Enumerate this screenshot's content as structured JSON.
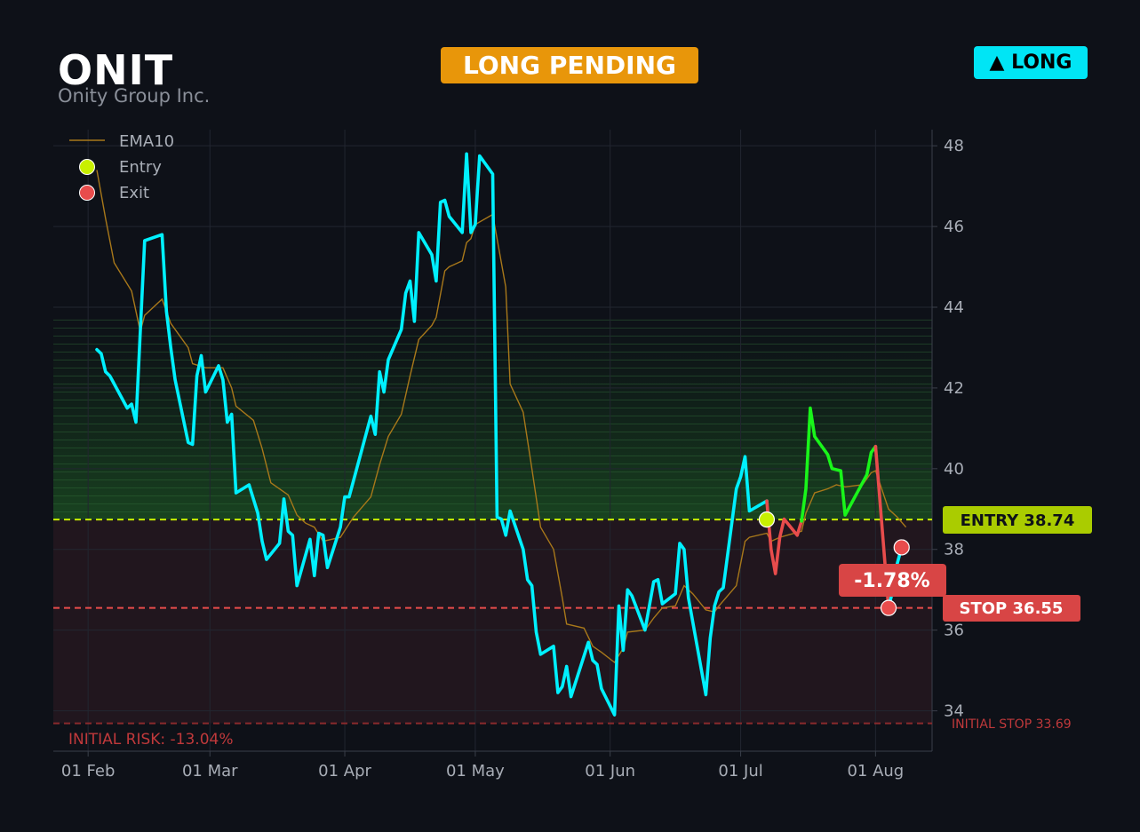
{
  "header": {
    "ticker": "ONIT",
    "company": "Onity Group Inc.",
    "status": "LONG PENDING",
    "direction": "▲ LONG"
  },
  "colors": {
    "background": "#0e1118",
    "price": "#00f0ff",
    "price_profit": "#19f51a",
    "price_loss": "#e84c4c",
    "ema": "#a8781a",
    "entry": "#c8f000",
    "stop": "#e84c4c",
    "status_badge": "#e8960a",
    "direction_badge": "#00e5f5"
  },
  "chart_data": {
    "type": "line",
    "x_ticks": [
      "01 Feb",
      "01 Mar",
      "01 Apr",
      "01 May",
      "01 Jun",
      "01 Jul",
      "01 Aug"
    ],
    "y_ticks": [
      34,
      36,
      38,
      40,
      42,
      44,
      46,
      48
    ],
    "ylim": [
      33.0,
      48.4
    ],
    "xlim": [
      "2025-01-24",
      "2025-08-14"
    ],
    "grid": true,
    "legend": {
      "position": "top-left",
      "entries": [
        {
          "label": "EMA10",
          "marker": "line"
        },
        {
          "label": "Entry",
          "marker": "dot"
        },
        {
          "label": "Exit",
          "marker": "dot"
        }
      ]
    },
    "series": [
      {
        "name": "Close",
        "points": [
          [
            "2025-02-03",
            42.95
          ],
          [
            "2025-02-04",
            42.85
          ],
          [
            "2025-02-05",
            42.4
          ],
          [
            "2025-02-06",
            42.3
          ],
          [
            "2025-02-10",
            41.5
          ],
          [
            "2025-02-11",
            41.6
          ],
          [
            "2025-02-12",
            41.15
          ],
          [
            "2025-02-14",
            45.65
          ],
          [
            "2025-02-18",
            45.8
          ],
          [
            "2025-02-19",
            43.9
          ],
          [
            "2025-02-20",
            43.0
          ],
          [
            "2025-02-21",
            42.2
          ],
          [
            "2025-02-24",
            40.65
          ],
          [
            "2025-02-25",
            40.6
          ],
          [
            "2025-02-26",
            42.3
          ],
          [
            "2025-02-27",
            42.8
          ],
          [
            "2025-02-28",
            41.9
          ],
          [
            "2025-03-03",
            42.55
          ],
          [
            "2025-03-04",
            42.2
          ],
          [
            "2025-03-05",
            41.15
          ],
          [
            "2025-03-06",
            41.35
          ],
          [
            "2025-03-07",
            39.4
          ],
          [
            "2025-03-10",
            39.6
          ],
          [
            "2025-03-12",
            38.9
          ],
          [
            "2025-03-13",
            38.2
          ],
          [
            "2025-03-14",
            37.75
          ],
          [
            "2025-03-17",
            38.15
          ],
          [
            "2025-03-18",
            39.25
          ],
          [
            "2025-03-19",
            38.45
          ],
          [
            "2025-03-20",
            38.35
          ],
          [
            "2025-03-21",
            37.1
          ],
          [
            "2025-03-24",
            38.25
          ],
          [
            "2025-03-25",
            37.35
          ],
          [
            "2025-03-26",
            38.4
          ],
          [
            "2025-03-27",
            38.35
          ],
          [
            "2025-03-28",
            37.55
          ],
          [
            "2025-03-31",
            38.55
          ],
          [
            "2025-04-01",
            39.3
          ],
          [
            "2025-04-02",
            39.3
          ],
          [
            "2025-04-03",
            39.7
          ],
          [
            "2025-04-07",
            41.3
          ],
          [
            "2025-04-08",
            40.85
          ],
          [
            "2025-04-09",
            42.4
          ],
          [
            "2025-04-10",
            41.9
          ],
          [
            "2025-04-11",
            42.7
          ],
          [
            "2025-04-14",
            43.45
          ],
          [
            "2025-04-15",
            44.35
          ],
          [
            "2025-04-16",
            44.65
          ],
          [
            "2025-04-17",
            43.65
          ],
          [
            "2025-04-18",
            45.85
          ],
          [
            "2025-04-21",
            45.3
          ],
          [
            "2025-04-22",
            44.65
          ],
          [
            "2025-04-23",
            46.6
          ],
          [
            "2025-04-24",
            46.65
          ],
          [
            "2025-04-25",
            46.25
          ],
          [
            "2025-04-28",
            45.85
          ],
          [
            "2025-04-29",
            47.8
          ],
          [
            "2025-04-30",
            45.85
          ],
          [
            "2025-05-01",
            46.05
          ],
          [
            "2025-05-02",
            47.75
          ],
          [
            "2025-05-05",
            47.3
          ],
          [
            "2025-05-06",
            38.8
          ],
          [
            "2025-05-07",
            38.75
          ],
          [
            "2025-05-08",
            38.35
          ],
          [
            "2025-05-09",
            38.95
          ],
          [
            "2025-05-12",
            38.0
          ],
          [
            "2025-05-13",
            37.25
          ],
          [
            "2025-05-14",
            37.1
          ],
          [
            "2025-05-15",
            35.95
          ],
          [
            "2025-05-16",
            35.4
          ],
          [
            "2025-05-19",
            35.6
          ],
          [
            "2025-05-20",
            34.45
          ],
          [
            "2025-05-21",
            34.6
          ],
          [
            "2025-05-22",
            35.1
          ],
          [
            "2025-05-23",
            34.35
          ],
          [
            "2025-05-27",
            35.7
          ],
          [
            "2025-05-28",
            35.25
          ],
          [
            "2025-05-29",
            35.15
          ],
          [
            "2025-05-30",
            34.55
          ],
          [
            "2025-06-02",
            33.9
          ],
          [
            "2025-06-03",
            36.6
          ],
          [
            "2025-06-04",
            35.5
          ],
          [
            "2025-06-05",
            37.0
          ],
          [
            "2025-06-06",
            36.85
          ],
          [
            "2025-06-09",
            36.0
          ],
          [
            "2025-06-10",
            36.6
          ],
          [
            "2025-06-11",
            37.2
          ],
          [
            "2025-06-12",
            37.25
          ],
          [
            "2025-06-13",
            36.65
          ],
          [
            "2025-06-16",
            36.9
          ],
          [
            "2025-06-17",
            38.15
          ],
          [
            "2025-06-18",
            38.0
          ],
          [
            "2025-06-19",
            36.8
          ],
          [
            "2025-06-23",
            34.4
          ],
          [
            "2025-06-24",
            35.8
          ],
          [
            "2025-06-25",
            36.6
          ],
          [
            "2025-06-26",
            36.95
          ],
          [
            "2025-06-27",
            37.05
          ],
          [
            "2025-06-30",
            39.5
          ],
          [
            "2025-07-01",
            39.8
          ],
          [
            "2025-07-02",
            40.3
          ],
          [
            "2025-07-03",
            38.95
          ],
          [
            "2025-07-07",
            39.2
          ],
          [
            "2025-07-08",
            38.0
          ],
          [
            "2025-07-09",
            37.4
          ],
          [
            "2025-07-10",
            38.3
          ],
          [
            "2025-07-11",
            38.75
          ],
          [
            "2025-07-14",
            38.35
          ],
          [
            "2025-07-15",
            38.7
          ],
          [
            "2025-07-16",
            39.5
          ],
          [
            "2025-07-17",
            41.5
          ],
          [
            "2025-07-18",
            40.8
          ],
          [
            "2025-07-21",
            40.35
          ],
          [
            "2025-07-22",
            40.0
          ],
          [
            "2025-07-24",
            39.95
          ],
          [
            "2025-07-25",
            38.85
          ],
          [
            "2025-07-28",
            39.45
          ],
          [
            "2025-07-29",
            39.65
          ],
          [
            "2025-07-30",
            39.85
          ],
          [
            "2025-07-31",
            40.4
          ],
          [
            "2025-08-01",
            40.55
          ],
          [
            "2025-08-04",
            36.55
          ],
          [
            "2025-08-05",
            37.0
          ],
          [
            "2025-08-06",
            37.65
          ],
          [
            "2025-08-07",
            38.05
          ]
        ]
      },
      {
        "name": "EMA10",
        "points": [
          [
            "2025-02-03",
            47.4
          ],
          [
            "2025-02-05",
            46.2
          ],
          [
            "2025-02-07",
            45.1
          ],
          [
            "2025-02-11",
            44.4
          ],
          [
            "2025-02-13",
            43.4
          ],
          [
            "2025-02-14",
            43.8
          ],
          [
            "2025-02-18",
            44.2
          ],
          [
            "2025-02-20",
            43.6
          ],
          [
            "2025-02-24",
            43.0
          ],
          [
            "2025-02-25",
            42.6
          ],
          [
            "2025-02-28",
            42.5
          ],
          [
            "2025-03-04",
            42.5
          ],
          [
            "2025-03-06",
            42.0
          ],
          [
            "2025-03-07",
            41.55
          ],
          [
            "2025-03-11",
            41.2
          ],
          [
            "2025-03-13",
            40.5
          ],
          [
            "2025-03-15",
            39.65
          ],
          [
            "2025-03-19",
            39.35
          ],
          [
            "2025-03-21",
            38.85
          ],
          [
            "2025-03-23",
            38.65
          ],
          [
            "2025-03-25",
            38.55
          ],
          [
            "2025-03-27",
            38.2
          ],
          [
            "2025-03-31",
            38.3
          ],
          [
            "2025-04-03",
            38.8
          ],
          [
            "2025-04-07",
            39.3
          ],
          [
            "2025-04-09",
            40.1
          ],
          [
            "2025-04-11",
            40.8
          ],
          [
            "2025-04-14",
            41.35
          ],
          [
            "2025-04-16",
            42.3
          ],
          [
            "2025-04-18",
            43.2
          ],
          [
            "2025-04-21",
            43.55
          ],
          [
            "2025-04-22",
            43.75
          ],
          [
            "2025-04-24",
            44.9
          ],
          [
            "2025-04-25",
            45.0
          ],
          [
            "2025-04-28",
            45.15
          ],
          [
            "2025-04-29",
            45.6
          ],
          [
            "2025-04-30",
            45.7
          ],
          [
            "2025-05-01",
            46.05
          ],
          [
            "2025-05-05",
            46.3
          ],
          [
            "2025-05-08",
            44.5
          ],
          [
            "2025-05-09",
            42.1
          ],
          [
            "2025-05-12",
            41.4
          ],
          [
            "2025-05-14",
            40.0
          ],
          [
            "2025-05-16",
            38.55
          ],
          [
            "2025-05-19",
            38.0
          ],
          [
            "2025-05-21",
            36.8
          ],
          [
            "2025-05-22",
            36.15
          ],
          [
            "2025-05-26",
            36.05
          ],
          [
            "2025-05-28",
            35.6
          ],
          [
            "2025-05-30",
            35.45
          ],
          [
            "2025-06-02",
            35.2
          ],
          [
            "2025-06-04",
            35.55
          ],
          [
            "2025-06-05",
            35.95
          ],
          [
            "2025-06-09",
            36.0
          ],
          [
            "2025-06-11",
            36.3
          ],
          [
            "2025-06-13",
            36.55
          ],
          [
            "2025-06-16",
            36.6
          ],
          [
            "2025-06-18",
            37.1
          ],
          [
            "2025-06-20",
            36.9
          ],
          [
            "2025-06-23",
            36.5
          ],
          [
            "2025-06-25",
            36.45
          ],
          [
            "2025-06-26",
            36.6
          ],
          [
            "2025-06-30",
            37.1
          ],
          [
            "2025-07-02",
            38.2
          ],
          [
            "2025-07-03",
            38.3
          ],
          [
            "2025-07-07",
            38.4
          ],
          [
            "2025-07-08",
            38.2
          ],
          [
            "2025-07-09",
            38.25
          ],
          [
            "2025-07-10",
            38.3
          ],
          [
            "2025-07-15",
            38.45
          ],
          [
            "2025-07-16",
            38.9
          ],
          [
            "2025-07-18",
            39.4
          ],
          [
            "2025-07-21",
            39.5
          ],
          [
            "2025-07-23",
            39.6
          ],
          [
            "2025-07-25",
            39.55
          ],
          [
            "2025-07-29",
            39.6
          ],
          [
            "2025-07-31",
            39.9
          ],
          [
            "2025-08-01",
            39.95
          ],
          [
            "2025-08-04",
            39.0
          ],
          [
            "2025-08-06",
            38.8
          ],
          [
            "2025-08-08",
            38.55
          ]
        ]
      }
    ],
    "trade_segments": [
      {
        "from": "2025-07-07",
        "to": "2025-07-15",
        "result": "loss"
      },
      {
        "from": "2025-07-15",
        "to": "2025-08-01",
        "result": "profit"
      },
      {
        "from": "2025-08-01",
        "to": "2025-08-04",
        "result": "loss"
      }
    ],
    "markers": [
      {
        "type": "entry",
        "date": "2025-07-07",
        "value": 38.74
      },
      {
        "type": "exit",
        "date": "2025-08-04",
        "value": 36.55
      },
      {
        "type": "exit",
        "date": "2025-08-07",
        "value": 38.05
      }
    ],
    "levels": {
      "entry": 38.74,
      "stop": 36.55,
      "initial_stop": 33.69
    },
    "labels": {
      "entry": "ENTRY 38.74",
      "stop": "STOP 36.55",
      "pnl": "-1.78%",
      "initial_stop": "INITIAL STOP 33.69",
      "initial_risk": "INITIAL RISK: -13.04%"
    }
  }
}
